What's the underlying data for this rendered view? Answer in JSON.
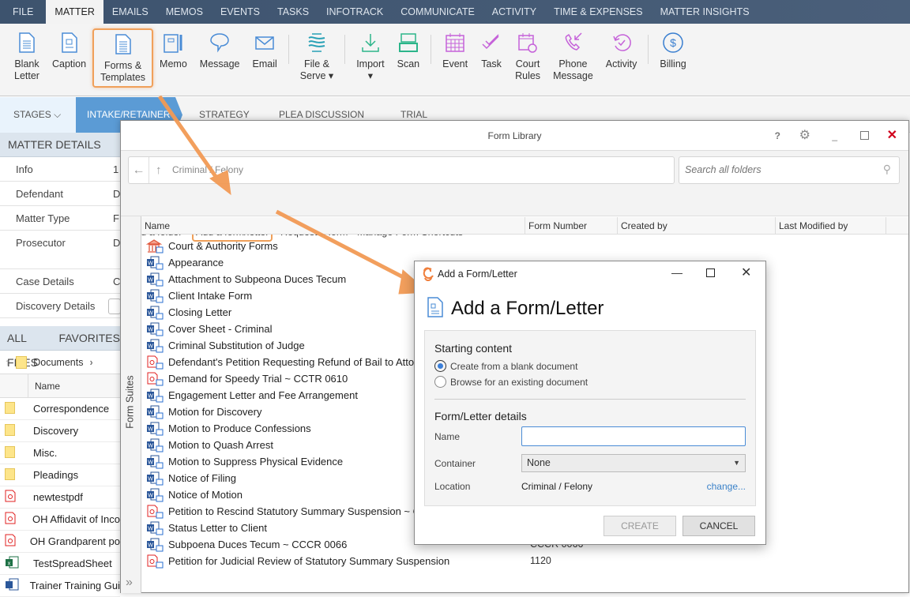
{
  "topbar": {
    "tabs": [
      "FILE",
      "MATTER",
      "EMAILS",
      "MEMOS",
      "EVENTS",
      "TASKS",
      "INFOTRACK",
      "COMMUNICATE",
      "ACTIVITY",
      "TIME & EXPENSES",
      "MATTER INSIGHTS"
    ],
    "active": "MATTER"
  },
  "ribbon": {
    "buttons": [
      {
        "l1": "Blank",
        "l2": "Letter",
        "icon": "document-icon"
      },
      {
        "l1": "Caption",
        "l2": "",
        "icon": "caption-icon"
      },
      {
        "l1": "Forms &",
        "l2": "Templates",
        "icon": "forms-icon"
      },
      {
        "l1": "Memo",
        "l2": "",
        "icon": "memo-icon"
      },
      {
        "l1": "Message",
        "l2": "",
        "icon": "message-icon"
      },
      {
        "l1": "Email",
        "l2": "",
        "icon": "email-icon"
      },
      {
        "l1": "File &",
        "l2": "Serve ▾",
        "icon": "file-serve-icon"
      },
      {
        "l1": "Import",
        "l2": "▾",
        "icon": "import-icon"
      },
      {
        "l1": "Scan",
        "l2": "",
        "icon": "scan-icon"
      },
      {
        "l1": "Event",
        "l2": "",
        "icon": "calendar-icon"
      },
      {
        "l1": "Task",
        "l2": "",
        "icon": "task-icon"
      },
      {
        "l1": "Court",
        "l2": "Rules",
        "icon": "court-rules-icon"
      },
      {
        "l1": "Phone",
        "l2": "Message",
        "icon": "phone-icon"
      },
      {
        "l1": "Activity",
        "l2": "",
        "icon": "activity-icon"
      },
      {
        "l1": "Billing",
        "l2": "",
        "icon": "billing-icon"
      }
    ]
  },
  "stages": {
    "label": "STAGES",
    "items": [
      "INTAKE/RETAINER",
      "STRATEGY",
      "PLEA DISCUSSION",
      "TRIAL"
    ],
    "active": "INTAKE/RETAINER"
  },
  "matter_details": {
    "title": "MATTER DETAILS",
    "rows": [
      {
        "k": "Info",
        "v": "1"
      },
      {
        "k": "Defendant",
        "v": "D"
      },
      {
        "k": "Matter Type",
        "v": "F"
      },
      {
        "k": "Prosecutor",
        "v": "D"
      },
      {
        "k": "Case Details",
        "v": "C"
      },
      {
        "k": "Discovery Details",
        "v": ""
      }
    ]
  },
  "files": {
    "tabs": [
      "ALL FILES",
      "FAVORITES"
    ],
    "folder": "Documents",
    "column": "Name",
    "items": [
      {
        "name": "Correspondence",
        "type": "folder"
      },
      {
        "name": "Discovery",
        "type": "folder"
      },
      {
        "name": "Misc.",
        "type": "folder"
      },
      {
        "name": "Pleadings",
        "type": "folder"
      },
      {
        "name": "newtestpdf",
        "type": "pdf"
      },
      {
        "name": "OH Affidavit of Inco",
        "type": "pdf"
      },
      {
        "name": "OH Grandparent po",
        "type": "pdf"
      },
      {
        "name": "TestSpreadSheet",
        "type": "xls"
      },
      {
        "name": "Trainer Training Gui",
        "type": "doc"
      }
    ]
  },
  "form_library": {
    "title": "Form Library",
    "path": "Criminal / Felony",
    "search_placeholder": "Search all folders",
    "actions": [
      "Add a folder",
      "Add a form/letter",
      "Request a form",
      "Manage Form Shortcuts"
    ],
    "side_label": "Form Suites",
    "columns": [
      "Name",
      "Form Number",
      "Created by",
      "Last Modified by"
    ],
    "rows": [
      {
        "name": "Court & Authority Forms",
        "type": "court",
        "num": ""
      },
      {
        "name": "Appearance",
        "type": "doc",
        "num": ""
      },
      {
        "name": "Attachment to Subpeona Duces Tecum",
        "type": "doc",
        "num": ""
      },
      {
        "name": "Client Intake Form",
        "type": "doc",
        "num": ""
      },
      {
        "name": "Closing Letter",
        "type": "doc",
        "num": ""
      },
      {
        "name": "Cover Sheet - Criminal",
        "type": "doc",
        "num": ""
      },
      {
        "name": "Criminal Substitution of Judge",
        "type": "doc",
        "num": ""
      },
      {
        "name": "Defendant's Petition Requesting Refund of Bail to Atto",
        "type": "pdf",
        "num": ""
      },
      {
        "name": "Demand for Speedy Trial ~ CCTR 0610",
        "type": "pdf",
        "num": ""
      },
      {
        "name": "Engagement Letter and Fee Arrangement",
        "type": "doc",
        "num": ""
      },
      {
        "name": "Motion for Discovery",
        "type": "doc",
        "num": ""
      },
      {
        "name": "Motion to Produce Confessions",
        "type": "doc",
        "num": ""
      },
      {
        "name": "Motion to Quash Arrest",
        "type": "doc",
        "num": ""
      },
      {
        "name": "Motion to Suppress Physical Evidence",
        "type": "doc",
        "num": ""
      },
      {
        "name": "Notice of Filing",
        "type": "doc",
        "num": ""
      },
      {
        "name": "Notice of Motion",
        "type": "doc",
        "num": ""
      },
      {
        "name": "Petition to Rescind Statutory Summary Suspension ~ C",
        "type": "pdf",
        "num": ""
      },
      {
        "name": "Status Letter to Client",
        "type": "doc",
        "num": ""
      },
      {
        "name": "Subpoena Duces Tecum ~ CCCR 0066",
        "type": "doc",
        "num": "CCCR 0066"
      },
      {
        "name": "Petition for Judicial Review of Statutory Summary Suspension",
        "type": "pdf",
        "num": "1120"
      }
    ]
  },
  "add_dialog": {
    "window_title": "Add a Form/Letter",
    "heading": "Add a Form/Letter",
    "starting_content": "Starting content",
    "options": [
      "Create from a blank document",
      "Browse for an existing document"
    ],
    "selected": 0,
    "details": "Form/Letter details",
    "name_label": "Name",
    "name_value": "",
    "container_label": "Container",
    "container_value": "None",
    "location_label": "Location",
    "location_value": "Criminal / Felony",
    "change_link": "change...",
    "create": "CREATE",
    "cancel": "CANCEL"
  },
  "colors": {
    "accent": "#5b9bd5",
    "highlight": "#f0a05a",
    "topbar": "#3d536e",
    "close": "#d0021b"
  }
}
